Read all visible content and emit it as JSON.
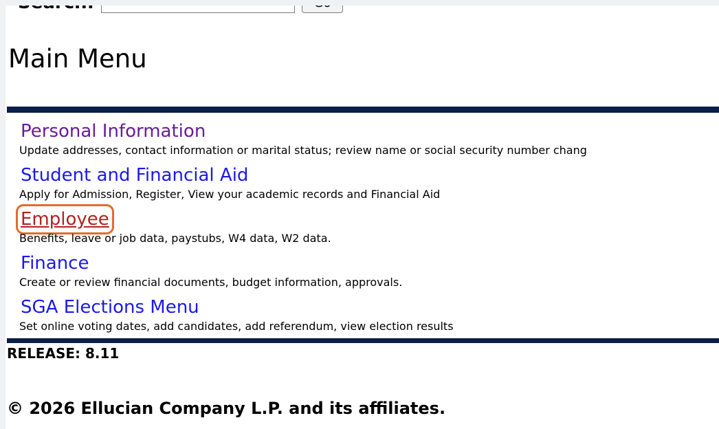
{
  "search": {
    "label": "Search:",
    "value": "",
    "button_label": "Go"
  },
  "page_title": "Main Menu",
  "menu": {
    "items": [
      {
        "label": "Personal Information",
        "description": "Update addresses, contact information or marital status; review name or social security number chang"
      },
      {
        "label": "Student and Financial Aid",
        "description": "Apply for Admission, Register, View your academic records and Financial Aid"
      },
      {
        "label": "Employee",
        "description": "Benefits, leave or job data, paystubs, W4 data, W2 data."
      },
      {
        "label": "Finance",
        "description": "Create or review financial documents, budget information, approvals."
      },
      {
        "label": "SGA Elections Menu",
        "description": "Set online voting dates, add candidates, add referendum, view election results"
      }
    ]
  },
  "footer": {
    "release": "RELEASE: 8.11",
    "copyright": "© 2026 Ellucian Company L.P. and its affiliates."
  },
  "colors": {
    "rule": "#0b1e47",
    "link": "#1a19e8",
    "visited_link": "#6a1b9a",
    "highlight_outline": "#e36b2c"
  }
}
